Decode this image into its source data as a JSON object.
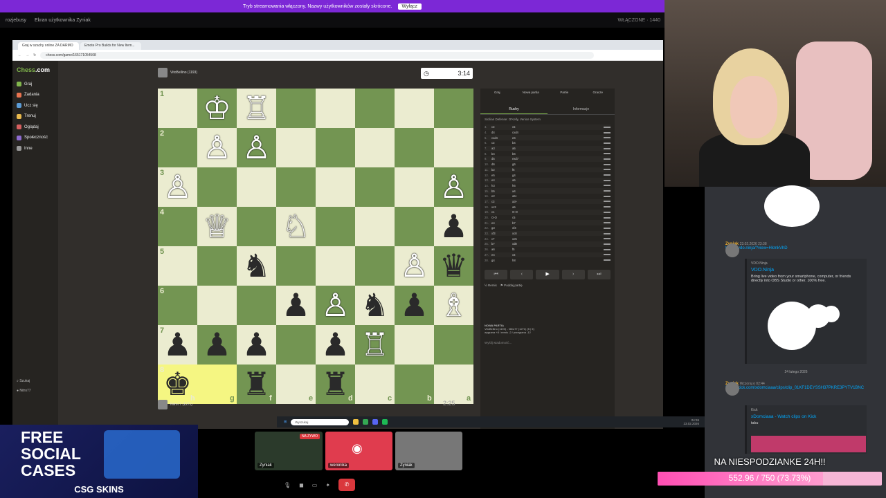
{
  "banner": {
    "text": "Tryb streamowania włączony. Nazwy użytkowników zostały skrócone.",
    "button": "Wyłącz"
  },
  "discord_header": {
    "server": "rozjebusy",
    "screen_title": "Ekran użytkownika Zyniak",
    "status": "WŁĄCZONE",
    "count": "1440"
  },
  "browser": {
    "tabs": [
      "Graj w szachy online ZA DARMO",
      "Emote Pro Builds for New Item..."
    ],
    "url": "chess.com/game/165171054508"
  },
  "chess_nav": {
    "logo": "Chess",
    "logo_suffix": ".com",
    "items": [
      "Graj",
      "Zadania",
      "Ucz się",
      "Trenuj",
      "Oglądaj",
      "Społeczność",
      "Inne"
    ],
    "item_colors": [
      "#81b64c",
      "#e8734f",
      "#5b9bd5",
      "#e9b94c",
      "#d65f5f",
      "#8d6bd0",
      "#999999"
    ],
    "search": "Szukaj",
    "user": "Nitro77"
  },
  "players": {
    "top": {
      "name": "VitoBellino (1193)",
      "clock": "3:14"
    },
    "bottom": {
      "name": "Nitro77 (1271)",
      "clock": "2:25"
    }
  },
  "board": {
    "ranks": [
      "1",
      "2",
      "3",
      "4",
      "5",
      "6",
      "7",
      "8"
    ],
    "files": [
      "h",
      "g",
      "f",
      "e",
      "d",
      "c",
      "b",
      "a"
    ],
    "highlight": [
      [
        7,
        0
      ],
      [
        7,
        1
      ]
    ],
    "pieces": [
      {
        "r": 0,
        "c": 1,
        "p": "♔",
        "color": "w"
      },
      {
        "r": 0,
        "c": 2,
        "p": "♖",
        "color": "w"
      },
      {
        "r": 1,
        "c": 1,
        "p": "♙",
        "color": "w"
      },
      {
        "r": 1,
        "c": 2,
        "p": "♙",
        "color": "w"
      },
      {
        "r": 2,
        "c": 0,
        "p": "♙",
        "color": "w"
      },
      {
        "r": 2,
        "c": 7,
        "p": "♙",
        "color": "w"
      },
      {
        "r": 3,
        "c": 1,
        "p": "♕",
        "color": "w"
      },
      {
        "r": 3,
        "c": 3,
        "p": "♘",
        "color": "w"
      },
      {
        "r": 3,
        "c": 7,
        "p": "♟",
        "color": "b"
      },
      {
        "r": 4,
        "c": 2,
        "p": "♞",
        "color": "b"
      },
      {
        "r": 4,
        "c": 6,
        "p": "♙",
        "color": "w"
      },
      {
        "r": 4,
        "c": 7,
        "p": "♛",
        "color": "b"
      },
      {
        "r": 5,
        "c": 3,
        "p": "♟",
        "color": "b"
      },
      {
        "r": 5,
        "c": 4,
        "p": "♙",
        "color": "w"
      },
      {
        "r": 5,
        "c": 5,
        "p": "♞",
        "color": "b"
      },
      {
        "r": 5,
        "c": 6,
        "p": "♟",
        "color": "b"
      },
      {
        "r": 5,
        "c": 7,
        "p": "♗",
        "color": "w"
      },
      {
        "r": 6,
        "c": 0,
        "p": "♟",
        "color": "b"
      },
      {
        "r": 6,
        "c": 1,
        "p": "♟",
        "color": "b"
      },
      {
        "r": 6,
        "c": 2,
        "p": "♟",
        "color": "b"
      },
      {
        "r": 6,
        "c": 4,
        "p": "♟",
        "color": "b"
      },
      {
        "r": 6,
        "c": 5,
        "p": "♖",
        "color": "w"
      },
      {
        "r": 7,
        "c": 0,
        "p": "♚",
        "color": "b"
      },
      {
        "r": 7,
        "c": 2,
        "p": "♜",
        "color": "b"
      },
      {
        "r": 7,
        "c": 4,
        "p": "♜",
        "color": "b"
      }
    ]
  },
  "panel": {
    "tabs": [
      "Graj",
      "Nowa partia",
      "Partie",
      "Gracze"
    ],
    "subtabs": [
      "Ruchy",
      "Informacje"
    ],
    "opening": "Sicilian Defense: O'Kelly, Venice System",
    "moves": [
      [
        "3.",
        "c3",
        "c5"
      ],
      [
        "4.",
        "d4",
        "cxd4"
      ],
      [
        "5.",
        "cxd4",
        "e6"
      ],
      [
        "6.",
        "c3",
        "b4"
      ],
      [
        "7.",
        "a3",
        "a5"
      ],
      [
        "8.",
        "b4",
        "b6"
      ],
      [
        "9.",
        "d5",
        "exd7"
      ],
      [
        "10.",
        "d6",
        "g6"
      ],
      [
        "11.",
        "b2",
        "f6"
      ],
      [
        "12.",
        "e5",
        "g4"
      ],
      [
        "13.",
        "e4",
        "a5"
      ],
      [
        "14.",
        "h3",
        "h6"
      ],
      [
        "15.",
        "b5",
        "a4"
      ],
      [
        "16.",
        "e2",
        "a5+"
      ],
      [
        "17.",
        "c3",
        "a3+"
      ],
      [
        "18.",
        "xc3",
        "a5"
      ],
      [
        "19.",
        "c1",
        "O-O"
      ],
      [
        "20.",
        "O-O",
        "c5"
      ],
      [
        "21.",
        "e4",
        "b7"
      ],
      [
        "22.",
        "g3",
        "xf3"
      ],
      [
        "23.",
        "xf3",
        "xc8"
      ],
      [
        "24.",
        "c7",
        "xe5"
      ],
      [
        "25.",
        "b7",
        "xd8"
      ],
      [
        "26.",
        "a6",
        "f5"
      ],
      [
        "27.",
        "e4",
        "c6"
      ],
      [
        "28.",
        "g4",
        "h8"
      ]
    ],
    "nav": [
      "⏮",
      "‹",
      "▶",
      "›",
      "⏭"
    ],
    "actions": [
      "Remis",
      "Poddaj partię"
    ],
    "new_game_title": "NOWA PARTIA",
    "new_game_players": "VitoBellino (1193) - Nitro77 (1271) (5 | 5)",
    "new_game_stats": "wygrana +8 / remis -2 / przegrana -12",
    "chat_placeholder": "Wyślij wiadomość..."
  },
  "taskbar": {
    "search": "Wyszukaj",
    "time": "04:26",
    "date": "23.02.2026"
  },
  "chat": {
    "msg1": {
      "user": "Zyniak",
      "time": "23.02.2026 23:38",
      "link": "https://vdo.ninja/?view=HkmkVhD",
      "embed_site": "VDO.Ninja",
      "embed_title": "VDO.Ninja",
      "embed_desc": "Bring live video from your smartphone, computer, or friends directly into OBS Studio or other. 100% free."
    },
    "divider": "24 lutego 2026",
    "msg2": {
      "user": "Zyniak",
      "time": "Wczoraj o 02:44",
      "link": "https://kick.com/xdomciaaa/clips/clip_01KF1DEYSSH37PKRE3PYTV1BNC",
      "embed_site": "Kick",
      "embed_title": "xDomciaaa - Watch clips on Kick",
      "embed_desc": "taku"
    }
  },
  "call": {
    "tiles": [
      {
        "name": "Zyniak",
        "badge": "NA ŻYWO",
        "color": "#2b3a2b"
      },
      {
        "name": "weronika",
        "badge": "",
        "color": "#e03c4e"
      },
      {
        "name": "Zyniak",
        "badge": "",
        "color": "#777777"
      }
    ]
  },
  "ad": {
    "line1": "FREE",
    "line2": "SOCIAL",
    "line3": "CASES",
    "brand": "CSG SKINS"
  },
  "goal": {
    "title": "NA NIESPODZIANKE 24H!!",
    "label": "552.96 / 750 (73.73%)",
    "fraction": 0.7373
  },
  "colors": {
    "accent": "#81b64c",
    "banner": "#7c28d6",
    "goal": "#ff4fb3"
  }
}
